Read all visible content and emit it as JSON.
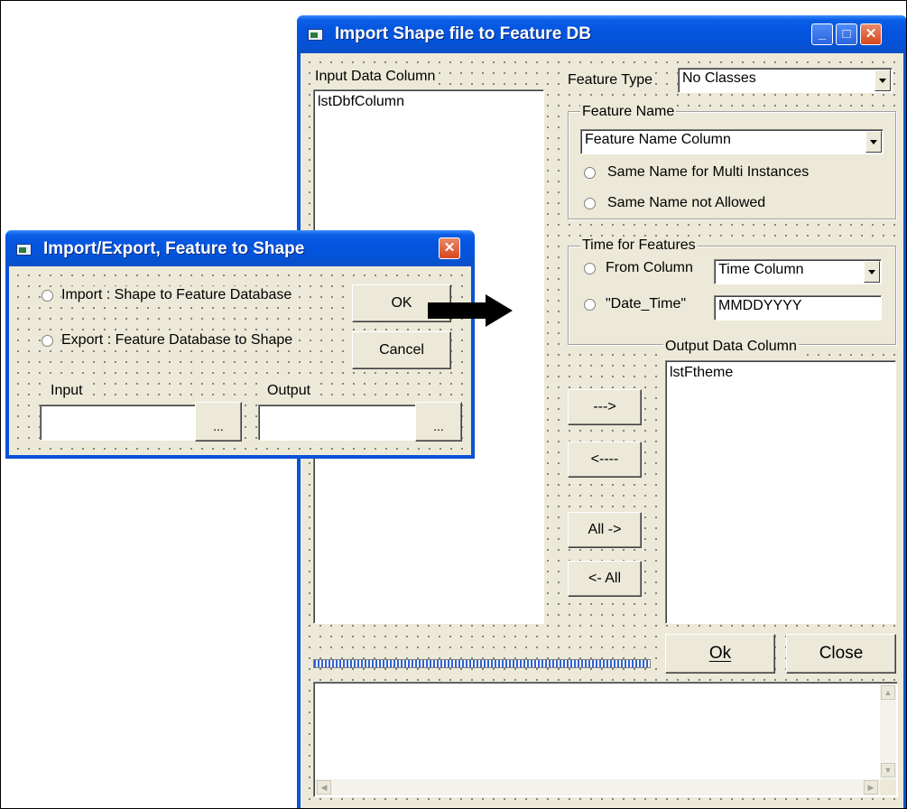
{
  "main_window": {
    "title": "Import Shape file to Feature DB",
    "input_column_label": "Input Data Column",
    "input_list_items": [
      "lstDbfColumn"
    ],
    "feature_type_label": "Feature Type",
    "feature_type_value": "No Classes",
    "feature_name_group": "Feature Name",
    "feature_name_value": "Feature Name Column",
    "radio_same_name_multi": "Same Name for Multi Instances",
    "radio_same_name_not_allowed": "Same Name not Allowed",
    "time_group": "Time for Features",
    "radio_from_column": "From Column",
    "time_column_value": "Time Column",
    "radio_date_time": "\"Date_Time\"",
    "date_format_value": "MMDDYYYY",
    "output_column_label": "Output Data Column",
    "output_list_items": [
      "lstFtheme"
    ],
    "btn_move_right": "--->",
    "btn_move_left": "<----",
    "btn_all_right": "All ->",
    "btn_all_left": "<- All",
    "btn_ok": "Ok",
    "btn_close": "Close"
  },
  "dialog": {
    "title": "Import/Export, Feature to Shape",
    "radio_import": "Import :  Shape to Feature Database",
    "radio_export": "Export :  Feature Database to Shape",
    "btn_ok": "OK",
    "btn_cancel": "Cancel",
    "input_label": "Input",
    "output_label": "Output",
    "browse_label": "..."
  },
  "colors": {
    "titlebar": "#0554e0",
    "face": "#ece9d8",
    "close_button": "#d8461e"
  }
}
